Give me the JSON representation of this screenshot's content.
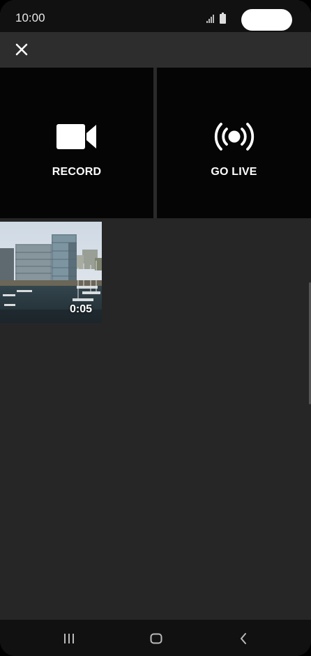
{
  "status_bar": {
    "time": "10:00",
    "icons": [
      "signal-icon",
      "battery-icon"
    ]
  },
  "toolbar": {
    "close_icon": "close-icon"
  },
  "actions": [
    {
      "label": "RECORD",
      "icon": "video-camera-icon"
    },
    {
      "label": "GO LIVE",
      "icon": "broadcast-icon"
    }
  ],
  "videos": [
    {
      "duration": "0:05"
    }
  ],
  "nav_bar": {
    "icons": [
      "recent-apps-icon",
      "home-icon",
      "back-icon"
    ]
  },
  "colors": {
    "background": "#262626",
    "tile_background": "#050505",
    "toolbar": "#2d2d2d",
    "text": "#ffffff"
  }
}
